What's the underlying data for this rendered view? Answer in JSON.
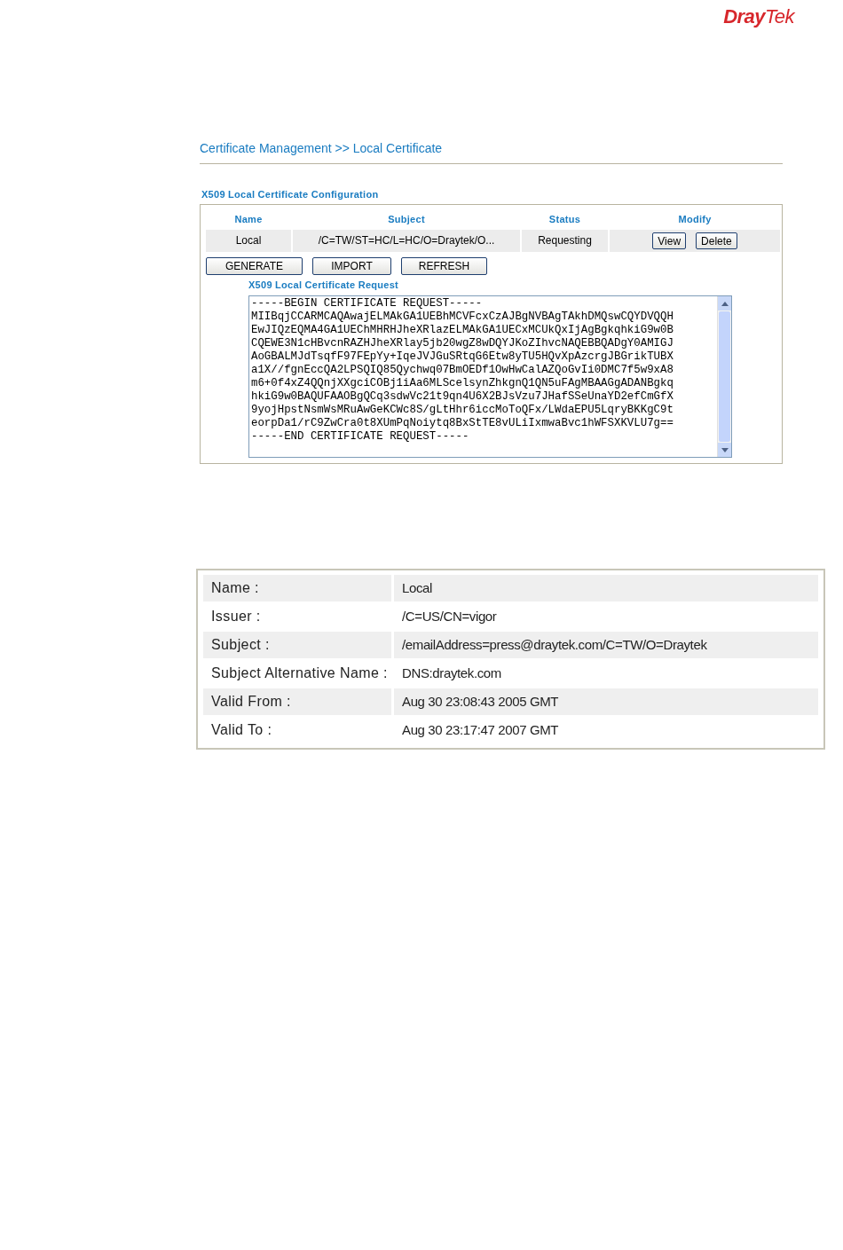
{
  "logo": "**Dray**Tek",
  "breadcrumb": "Certificate Management >> Local Certificate",
  "configuration": {
    "title": "X509 Local Certificate Configuration",
    "columns": [
      "Name",
      "Subject",
      "Status",
      "Modify"
    ],
    "rows": [
      {
        "name": "Local",
        "subject": "/C=TW/ST=HC/L=HC/O=Draytek/O...",
        "status": "Requesting",
        "actions": [
          "View",
          "Delete"
        ]
      }
    ],
    "buttons": [
      "GENERATE",
      "IMPORT",
      "REFRESH"
    ]
  },
  "request": {
    "title": "X509 Local Certificate Request",
    "lines": [
      "-----BEGIN CERTIFICATE REQUEST-----",
      "MIIBqjCCARMCAQAwajELMAkGA1UEBhMCVFcxCzAJBgNVBAgTAkhDMQswCQYDVQQH",
      "EwJIQzEQMA4GA1UEChMHRHJheXRlazELMAkGA1UECxMCUkQxIjAgBgkqhkiG9w0B",
      "CQEWE3N1cHBvcnRAZHJheXRlay5jb20wgZ8wDQYJKoZIhvcNAQEBBQADgY0AMIGJ",
      "AoGBALMJdTsqfF97FEpYy+IqeJVJGuSRtqG6Etw8yTU5HQvXpAzcrgJBGrikTUBX",
      "a1X//fgnEccQA2LPSQIQ85Qychwq07BmOEDf1OwHwCalAZQoGvIi0DMC7f5w9xA8",
      "m6+0f4xZ4QQnjXXgciCOBj1iAa6MLScelsynZhkgnQ1QN5uFAgMBAAGgADANBgkq",
      "hkiG9w0BAQUFAAOBgQCq3sdwVc21t9qn4U6X2BJsVzu7JHafSSeUnaYD2efCmGfX",
      "9yojHpstNsmWsMRuAwGeKCWc8S/gLtHhr6iccMoToQFx/LWdaEPU5LqryBKKgC9t",
      "eorpDa1/rC9ZwCra0t8XUmPqNoiytq8BxStTE8vULiIxmwaBvc1hWFSXKVLU7g==",
      "-----END CERTIFICATE REQUEST-----"
    ]
  },
  "details": [
    {
      "label": "Name :",
      "value": "Local"
    },
    {
      "label": "Issuer :",
      "value": "/C=US/CN=vigor"
    },
    {
      "label": "Subject :",
      "value": "/emailAddress=press@draytek.com/C=TW/O=Draytek"
    },
    {
      "label": "Subject Alternative Name :",
      "value": "DNS:draytek.com"
    },
    {
      "label": "Valid From :",
      "value": "Aug 30 23:08:43 2005 GMT"
    },
    {
      "label": "Valid To :",
      "value": "Aug 30 23:17:47 2007 GMT"
    }
  ]
}
